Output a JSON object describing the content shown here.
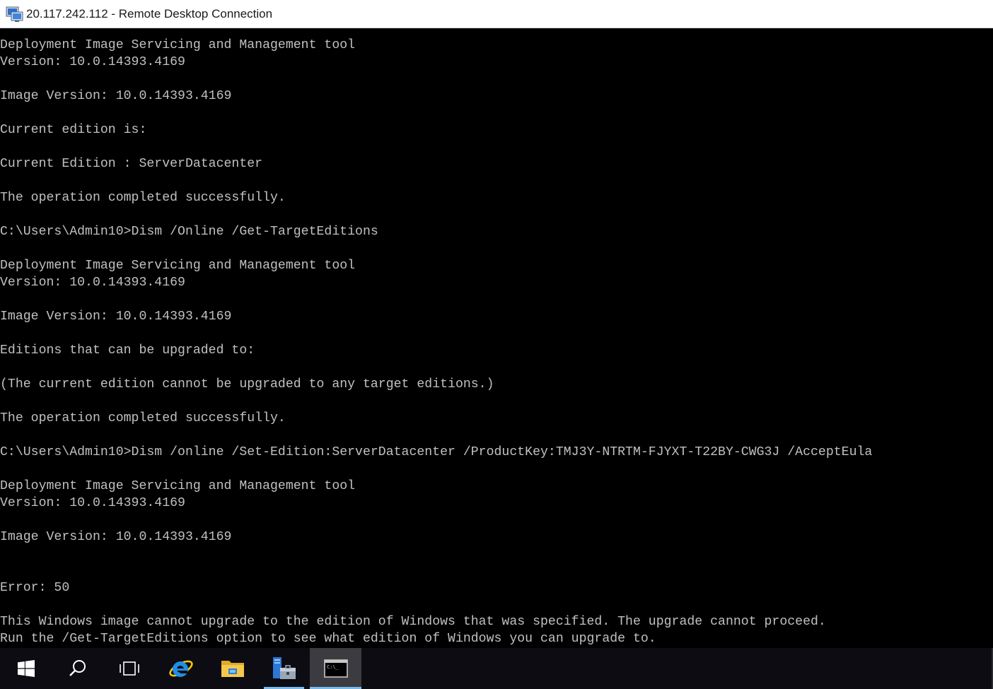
{
  "window": {
    "title": "20.117.242.112 - Remote Desktop Connection",
    "icon": "remote-desktop-icon"
  },
  "console": {
    "background": "#000000",
    "foreground": "#c0c0c0",
    "lines": [
      "Deployment Image Servicing and Management tool",
      "Version: 10.0.14393.4169",
      "",
      "Image Version: 10.0.14393.4169",
      "",
      "Current edition is:",
      "",
      "Current Edition : ServerDatacenter",
      "",
      "The operation completed successfully.",
      "",
      "C:\\Users\\Admin10>Dism /Online /Get-TargetEditions",
      "",
      "Deployment Image Servicing and Management tool",
      "Version: 10.0.14393.4169",
      "",
      "Image Version: 10.0.14393.4169",
      "",
      "Editions that can be upgraded to:",
      "",
      "(The current edition cannot be upgraded to any target editions.)",
      "",
      "The operation completed successfully.",
      "",
      "C:\\Users\\Admin10>Dism /online /Set-Edition:ServerDatacenter /ProductKey:TMJ3Y-NTRTM-FJYXT-T22BY-CWG3J /AcceptEula",
      "",
      "Deployment Image Servicing and Management tool",
      "Version: 10.0.14393.4169",
      "",
      "Image Version: 10.0.14393.4169",
      "",
      "",
      "Error: 50",
      "",
      "This Windows image cannot upgrade to the edition of Windows that was specified. The upgrade cannot proceed.",
      "Run the /Get-TargetEditions option to see what edition of Windows you can upgrade to."
    ]
  },
  "taskbar": {
    "background": "#0c0c12",
    "accent": "#76b9ed",
    "items": [
      {
        "name": "start-button",
        "icon": "windows-logo-icon"
      },
      {
        "name": "search-button",
        "icon": "search-icon"
      },
      {
        "name": "task-view-button",
        "icon": "task-view-icon"
      },
      {
        "name": "internet-explorer-button",
        "icon": "internet-explorer-icon"
      },
      {
        "name": "file-explorer-button",
        "icon": "folder-icon"
      },
      {
        "name": "server-manager-button",
        "icon": "server-manager-icon"
      },
      {
        "name": "command-prompt-button",
        "icon": "command-prompt-icon",
        "active": true
      }
    ]
  }
}
